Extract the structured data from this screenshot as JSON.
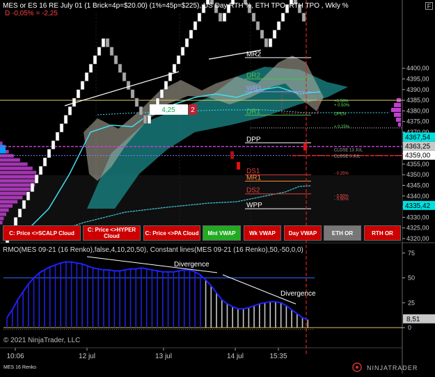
{
  "header": {
    "title": "MES or ES 16 RE July 01 (1 Brick=4p=$20.00) (1%=45p=$225), US Day RTH %, ETH TPO, RTH TPO , Wkly %",
    "change": "D -0,05% = -2,25",
    "window_btn": "F"
  },
  "copyright": "© 2021 NinjaTrader, LLC",
  "footer_instrument": "MES 16 Renko",
  "logo_text": "NINJATRADER",
  "lower_title": "RMO(MES 09-21 (16 Renko),false,4,10,20,50), Constant lines(MES 09-21 (16 Renko),50,-50,0,0)",
  "buttons": [
    {
      "label": "C: Price <>SCALP Cloud",
      "color": "#cc0000"
    },
    {
      "label": "C: Price <>HYPER Cloud",
      "color": "#cc0000"
    },
    {
      "label": "C: Price <>PA Cloud",
      "color": "#cc0000"
    },
    {
      "label": "Mnt VWAP",
      "color": "#22aa22"
    },
    {
      "label": "Wk VWAP",
      "color": "#cc0000"
    },
    {
      "label": "Day VWAP",
      "color": "#cc0000"
    },
    {
      "label": "ETH OR",
      "color": "#777777"
    },
    {
      "label": "RTH OR",
      "color": "#cc0000"
    }
  ],
  "colors": {
    "up_brick": "#ffffff",
    "down_brick": "#a8a8a8",
    "cloud_teal": "#1b8a8a",
    "cloud_gray": "#b8b2a4",
    "profile": "#c040d0",
    "rmo_blue": "#2020e0",
    "rmo_gray": "#c8c8c8"
  },
  "chart_data": [
    {
      "type": "candlestick",
      "name": "MES 16 Renko price chart",
      "ylim": [
        4315,
        4405
      ],
      "y_ticks": [
        4320,
        4325,
        4330,
        4335,
        4340,
        4345,
        4350,
        4355,
        4360,
        4365,
        4370,
        4375,
        4380,
        4385,
        4390,
        4395,
        4400
      ],
      "x_ticks": [
        "10:06",
        "12 jul",
        "13 jul",
        "14 jul",
        "15:35"
      ],
      "price_labels": [
        {
          "text": "4367,54",
          "value": 4367.54,
          "bg": "#00e0e0"
        },
        {
          "text": "4363,25",
          "value": 4363.25,
          "bg": "#c8c8c8"
        },
        {
          "text": "4359,00",
          "value": 4359.0,
          "bg": "#ffffff"
        },
        {
          "text": "4335,42",
          "value": 4335.42,
          "bg": "#00e0e0"
        }
      ],
      "bricks_direction": [
        1,
        1,
        1,
        1,
        1,
        1,
        1,
        1,
        1,
        1,
        1,
        1,
        1,
        1,
        1,
        1,
        1,
        1,
        1,
        1,
        1,
        1,
        1,
        1,
        -1,
        -1,
        -1,
        -1,
        -1,
        -1,
        -1,
        -1,
        -1,
        -1,
        1,
        1,
        1,
        1,
        1,
        1,
        1,
        1,
        1,
        1,
        1,
        1,
        1,
        1,
        1,
        -1,
        -1,
        -1,
        1,
        1,
        1,
        1,
        -1,
        -1,
        -1,
        -1,
        -1,
        -1,
        -1,
        1,
        1,
        1,
        1,
        1,
        1,
        -1,
        -1,
        -1
      ],
      "brick_start": 4318,
      "brick_size": 4,
      "levels": [
        {
          "label": "MR2",
          "value": 4405,
          "color": "#ffffff"
        },
        {
          "label": "DR2",
          "value": 4395,
          "color": "#4fc04f"
        },
        {
          "label": "WR1",
          "value": 4389,
          "color": "#9a9aff"
        },
        {
          "label": "DR1",
          "value": 4378,
          "color": "#4fc04f"
        },
        {
          "label": "DPP",
          "value": 4365,
          "color": "#ffffff"
        },
        {
          "label": "DS1",
          "value": 4350,
          "color": "#e04040"
        },
        {
          "label": "MR1",
          "value": 4347,
          "color": "#ff9040"
        },
        {
          "label": "DS2",
          "value": 4341,
          "color": "#e04040"
        },
        {
          "label": "WPP",
          "value": 4334,
          "color": "#ffffff"
        }
      ],
      "pct_labels": [
        {
          "text": "+0,50%",
          "value": 4385
        },
        {
          "text": "+ 0.50%",
          "value": 4383
        },
        {
          "text": "OPEN",
          "value": 4379
        },
        {
          "text": "+ 0.25%",
          "value": 4373
        },
        {
          "text": "CLOSE 13 JUL",
          "value": 4362
        },
        {
          "text": "CLOSE 9 JUL",
          "value": 4359
        },
        {
          "text": "- 0.25%",
          "value": 4351
        },
        {
          "text": "- 0.50%",
          "value": 4340.5
        },
        {
          "text": "- 0.50%",
          "value": 4339
        }
      ],
      "callout_value": "4,25",
      "callout_count": "2"
    },
    {
      "type": "bar",
      "name": "RMO oscillator",
      "ylim": [
        -5,
        75
      ],
      "y_ticks": [
        0,
        25,
        50,
        75
      ],
      "current_value": "8,51",
      "annotations": [
        "Divergence",
        "Divergence"
      ],
      "values": [
        10,
        18,
        28,
        36,
        44,
        50,
        55,
        58,
        61,
        63,
        65,
        66,
        66,
        65,
        64,
        62,
        60,
        59,
        58,
        58,
        57,
        57,
        58,
        59,
        59,
        60,
        59,
        58,
        57,
        56,
        56,
        56,
        57,
        58,
        58,
        56,
        53,
        48,
        42,
        35,
        28,
        24,
        21,
        19,
        19,
        20,
        22,
        24,
        25,
        26,
        26,
        25,
        22,
        18,
        14,
        10,
        8
      ],
      "colors_split_index": 37
    }
  ]
}
